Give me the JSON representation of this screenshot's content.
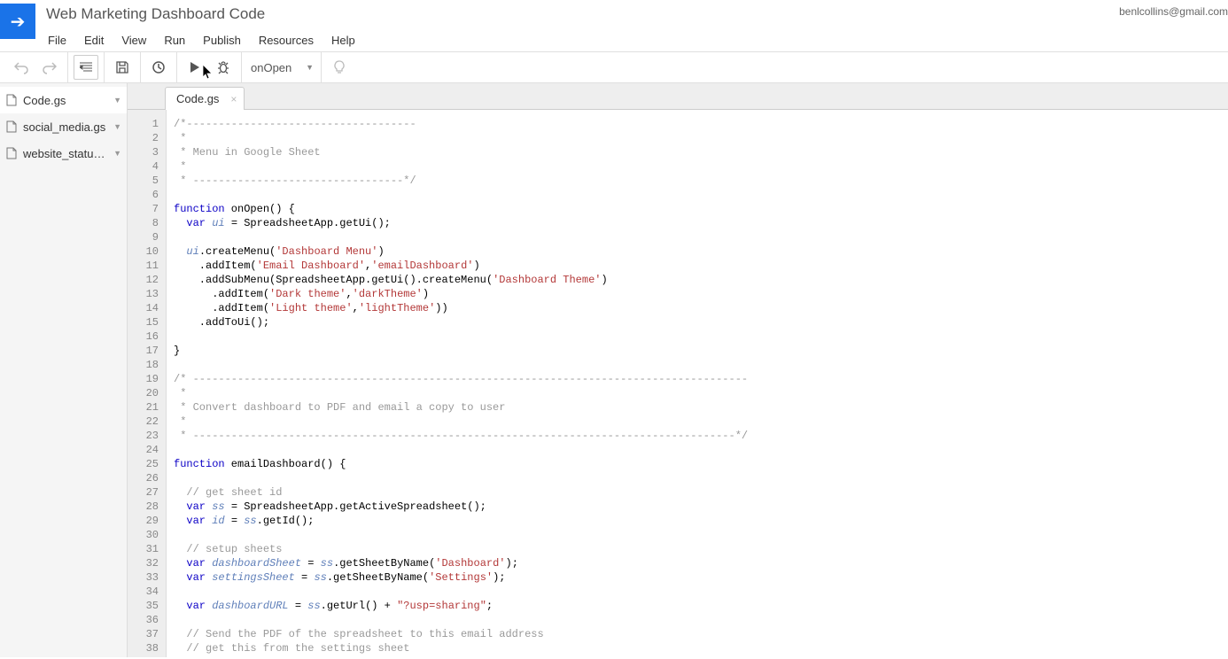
{
  "header": {
    "doc_title": "Web Marketing Dashboard Code",
    "user_email": "benlcollins@gmail.com",
    "menu": [
      "File",
      "Edit",
      "View",
      "Run",
      "Publish",
      "Resources",
      "Help"
    ]
  },
  "toolbar": {
    "function_selected": "onOpen"
  },
  "sidebar": {
    "files": [
      {
        "name": "Code.gs",
        "active": true
      },
      {
        "name": "social_media.gs",
        "active": false
      },
      {
        "name": "website_statu…",
        "active": false
      }
    ]
  },
  "tabs": {
    "active_tab": "Code.gs"
  },
  "code": {
    "lines": [
      {
        "n": 1,
        "tokens": [
          [
            "/*------------------------------------",
            "comment"
          ]
        ]
      },
      {
        "n": 2,
        "tokens": [
          [
            " *",
            "comment"
          ]
        ]
      },
      {
        "n": 3,
        "tokens": [
          [
            " * Menu in Google Sheet",
            "comment"
          ]
        ]
      },
      {
        "n": 4,
        "tokens": [
          [
            " *",
            "comment"
          ]
        ]
      },
      {
        "n": 5,
        "tokens": [
          [
            " * ---------------------------------*/",
            "comment"
          ]
        ]
      },
      {
        "n": 6,
        "tokens": [
          [
            "",
            ""
          ]
        ]
      },
      {
        "n": 7,
        "tokens": [
          [
            "function",
            "keyword"
          ],
          [
            " onOpen",
            ""
          ],
          [
            "()",
            ""
          ],
          [
            " {",
            ""
          ]
        ]
      },
      {
        "n": 8,
        "tokens": [
          [
            "  ",
            ""
          ],
          [
            "var",
            "keyword"
          ],
          [
            " ",
            ""
          ],
          [
            "ui",
            "var"
          ],
          [
            " = SpreadsheetApp.getUi();",
            ""
          ]
        ]
      },
      {
        "n": 9,
        "tokens": [
          [
            "",
            ""
          ]
        ]
      },
      {
        "n": 10,
        "tokens": [
          [
            "  ",
            ""
          ],
          [
            "ui",
            "var"
          ],
          [
            ".createMenu(",
            ""
          ],
          [
            "'Dashboard Menu'",
            "string"
          ],
          [
            ")",
            ""
          ]
        ]
      },
      {
        "n": 11,
        "tokens": [
          [
            "    .addItem(",
            ""
          ],
          [
            "'Email Dashboard'",
            "string"
          ],
          [
            ",",
            ""
          ],
          [
            "'emailDashboard'",
            "string"
          ],
          [
            ")",
            ""
          ]
        ]
      },
      {
        "n": 12,
        "tokens": [
          [
            "    .addSubMenu(SpreadsheetApp.getUi().createMenu(",
            ""
          ],
          [
            "'Dashboard Theme'",
            "string"
          ],
          [
            ")",
            ""
          ]
        ]
      },
      {
        "n": 13,
        "tokens": [
          [
            "      .addItem(",
            ""
          ],
          [
            "'Dark theme'",
            "string"
          ],
          [
            ",",
            ""
          ],
          [
            "'darkTheme'",
            "string"
          ],
          [
            ")",
            ""
          ]
        ]
      },
      {
        "n": 14,
        "tokens": [
          [
            "      .addItem(",
            ""
          ],
          [
            "'Light theme'",
            "string"
          ],
          [
            ",",
            ""
          ],
          [
            "'lightTheme'",
            "string"
          ],
          [
            "))",
            ""
          ]
        ]
      },
      {
        "n": 15,
        "tokens": [
          [
            "    .addToUi();",
            ""
          ]
        ]
      },
      {
        "n": 16,
        "tokens": [
          [
            "",
            ""
          ]
        ]
      },
      {
        "n": 17,
        "tokens": [
          [
            "}",
            ""
          ]
        ]
      },
      {
        "n": 18,
        "tokens": [
          [
            "",
            ""
          ]
        ]
      },
      {
        "n": 19,
        "tokens": [
          [
            "/* ---------------------------------------------------------------------------------------",
            "comment"
          ]
        ]
      },
      {
        "n": 20,
        "tokens": [
          [
            " *",
            "comment"
          ]
        ]
      },
      {
        "n": 21,
        "tokens": [
          [
            " * Convert dashboard to PDF and email a copy to user",
            "comment"
          ]
        ]
      },
      {
        "n": 22,
        "tokens": [
          [
            " *",
            "comment"
          ]
        ]
      },
      {
        "n": 23,
        "tokens": [
          [
            " * -------------------------------------------------------------------------------------*/",
            "comment"
          ]
        ]
      },
      {
        "n": 24,
        "tokens": [
          [
            "",
            ""
          ]
        ]
      },
      {
        "n": 25,
        "tokens": [
          [
            "function",
            "keyword"
          ],
          [
            " emailDashboard",
            ""
          ],
          [
            "()",
            ""
          ],
          [
            " {",
            ""
          ]
        ]
      },
      {
        "n": 26,
        "tokens": [
          [
            "",
            ""
          ]
        ]
      },
      {
        "n": 27,
        "tokens": [
          [
            "  ",
            ""
          ],
          [
            "// get sheet id",
            "comment"
          ]
        ]
      },
      {
        "n": 28,
        "tokens": [
          [
            "  ",
            ""
          ],
          [
            "var",
            "keyword"
          ],
          [
            " ",
            ""
          ],
          [
            "ss",
            "var"
          ],
          [
            " = SpreadsheetApp.getActiveSpreadsheet();",
            ""
          ]
        ]
      },
      {
        "n": 29,
        "tokens": [
          [
            "  ",
            ""
          ],
          [
            "var",
            "keyword"
          ],
          [
            " ",
            ""
          ],
          [
            "id",
            "var"
          ],
          [
            " = ",
            ""
          ],
          [
            "ss",
            "var"
          ],
          [
            ".getId();",
            ""
          ]
        ]
      },
      {
        "n": 30,
        "tokens": [
          [
            "",
            ""
          ]
        ]
      },
      {
        "n": 31,
        "tokens": [
          [
            "  ",
            ""
          ],
          [
            "// setup sheets",
            "comment"
          ]
        ]
      },
      {
        "n": 32,
        "tokens": [
          [
            "  ",
            ""
          ],
          [
            "var",
            "keyword"
          ],
          [
            " ",
            ""
          ],
          [
            "dashboardSheet",
            "var"
          ],
          [
            " = ",
            ""
          ],
          [
            "ss",
            "var"
          ],
          [
            ".getSheetByName(",
            ""
          ],
          [
            "'Dashboard'",
            "string"
          ],
          [
            ");",
            ""
          ]
        ]
      },
      {
        "n": 33,
        "tokens": [
          [
            "  ",
            ""
          ],
          [
            "var",
            "keyword"
          ],
          [
            " ",
            ""
          ],
          [
            "settingsSheet",
            "var"
          ],
          [
            " = ",
            ""
          ],
          [
            "ss",
            "var"
          ],
          [
            ".getSheetByName(",
            ""
          ],
          [
            "'Settings'",
            "string"
          ],
          [
            ");",
            ""
          ]
        ]
      },
      {
        "n": 34,
        "tokens": [
          [
            "",
            ""
          ]
        ]
      },
      {
        "n": 35,
        "tokens": [
          [
            "  ",
            ""
          ],
          [
            "var",
            "keyword"
          ],
          [
            " ",
            ""
          ],
          [
            "dashboardURL",
            "var"
          ],
          [
            " = ",
            ""
          ],
          [
            "ss",
            "var"
          ],
          [
            ".getUrl() + ",
            ""
          ],
          [
            "\"?usp=sharing\"",
            "string"
          ],
          [
            ";",
            ""
          ]
        ]
      },
      {
        "n": 36,
        "tokens": [
          [
            "",
            ""
          ]
        ]
      },
      {
        "n": 37,
        "tokens": [
          [
            "  ",
            ""
          ],
          [
            "// Send the PDF of the spreadsheet to this email address",
            "comment"
          ]
        ]
      },
      {
        "n": 38,
        "tokens": [
          [
            "  ",
            ""
          ],
          [
            "// get this from the settings sheet",
            "comment"
          ]
        ]
      }
    ]
  }
}
